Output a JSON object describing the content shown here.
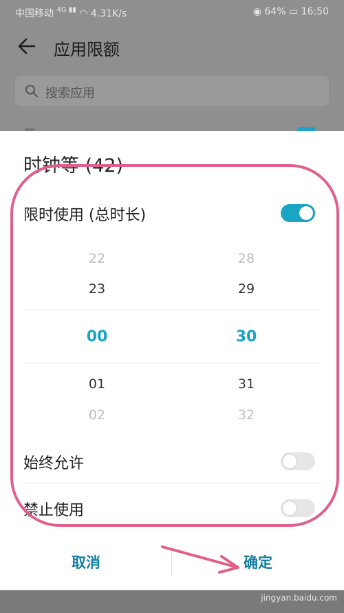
{
  "status_bar": {
    "carrier": "中国移动",
    "network": "4.31K/s",
    "battery": "64%",
    "time": "16:50"
  },
  "app_bar": {
    "title": "应用限额"
  },
  "search": {
    "placeholder": "搜索应用"
  },
  "sheet": {
    "title": "时钟等 (42)",
    "limit_row": {
      "label": "限时使用 (总时长)",
      "on": true
    },
    "picker": {
      "hours": [
        "22",
        "23",
        "00",
        "01",
        "02"
      ],
      "minutes": [
        "28",
        "29",
        "30",
        "31",
        "32"
      ]
    },
    "always_allow": {
      "label": "始终允许",
      "on": false
    },
    "forbid": {
      "label": "禁止使用",
      "on": false
    },
    "cancel_label": "取消",
    "confirm_label": "确定"
  },
  "watermark": "jingyan.baidu.com",
  "colors": {
    "accent": "#1aa5c5",
    "button_text": "#157fa1",
    "annotation": "#e0608a"
  }
}
